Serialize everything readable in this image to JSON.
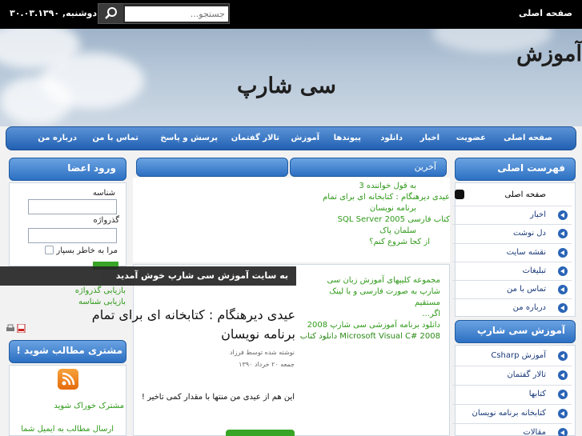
{
  "topbar": {
    "home_label": "صفحه اصلی",
    "search_placeholder": "جستجو...",
    "date": "دوشنبه, ۳۰.۰۳.۱۳۹۰"
  },
  "header": {
    "title_line1": "آموزش",
    "title_line2": "سی شارپ"
  },
  "nav": {
    "items": [
      "صفحه اصلی",
      "عضویت",
      "اخبار",
      "دانلود",
      "پیوندها",
      "آموزش",
      "تالار گفتمان",
      "پرسش و پاسخ",
      "تماس با من",
      "درباره من"
    ]
  },
  "right": {
    "main_menu_title": "فهرست اصلی",
    "main_menu": [
      "صفحه اصلی",
      "اخبار",
      "دل نوشت",
      "نقشه سایت",
      "تبلیغات",
      "تماس با من",
      "درباره من"
    ],
    "csharp_title": "آموزش سی شارپ",
    "csharp_menu": [
      "آموزش Csharp",
      "تالار گفتمان",
      "کتابها",
      "کتابخانه برنامه نویسان",
      "مقالات"
    ]
  },
  "center": {
    "latest_tab": "آخرین",
    "latest_links": [
      "به قول خواننده 3",
      "عیدی دیرهنگام : کتابخانه ای برای تمام",
      "برنامه نویسان",
      "کتاب فارسی SQL Server 2005",
      "سلمان پاک",
      "از کجا شروع کنم؟"
    ],
    "links2": [
      "مجموعه کلیپهای آموزش زبان سی",
      "شارپ به صورت فارسی و با لینک",
      "مستقیم",
      "اگر...",
      "دانلود برنامه آموزشی سی شارپ 2008",
      "Microsoft Visual C# 2008 دانلود کتاب"
    ],
    "article_title_1": "عیدی دیرهنگام : کتابخانه ای برای تمام",
    "article_title_2": "برنامه نویسان",
    "article_author": "نوشته شده توسط فرزاد",
    "article_date": "جمعه ۲۰ خرداد ۱۳۹۰",
    "article_text": "این هم از عیدی من منتها با مقدار کمی تاخیر !"
  },
  "left": {
    "login_title": "ورود اعضا",
    "username_label": "شناسه",
    "password_label": "گذرواژه",
    "remember_label": "مرا به خاطر بسپار",
    "recover1": "بازیابی گذرواژه",
    "recover2": "بازیابی شناسه",
    "subscribe_title": "مشتری مطالب شوید !",
    "rss_label": "مشترک خوراک شوید",
    "email_label": "ارسال مطالب به ایمیل شما"
  },
  "welcome": "به سایت آموزش سی شارپ خوش آمدید"
}
